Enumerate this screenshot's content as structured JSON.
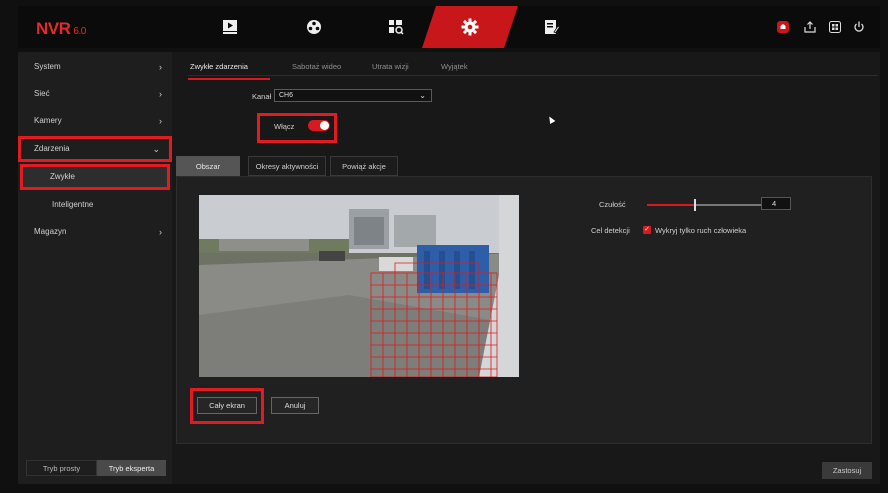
{
  "header": {
    "logo": "NVR",
    "version": "6.0",
    "nav": [
      "playback-icon",
      "camera-lens-icon",
      "search-file-icon",
      "settings-gear-icon",
      "edit-doc-icon"
    ],
    "active_nav": "settings-gear-icon",
    "system_icons": [
      "alarm-bell-icon",
      "backup-icon",
      "grid-icon",
      "power-icon"
    ],
    "accent": "#c8171b"
  },
  "sidebar": {
    "items": [
      {
        "label": "System",
        "chevron": "›"
      },
      {
        "label": "Sieć",
        "chevron": "›"
      },
      {
        "label": "Kamery",
        "chevron": "›"
      },
      {
        "label": "Zdarzenia",
        "chevron": "⌄"
      },
      {
        "label": "Zwykłe"
      },
      {
        "label": "Inteligentne"
      },
      {
        "label": "Magazyn",
        "chevron": "›"
      }
    ],
    "mode_simple": "Tryb prosty",
    "mode_expert": "Tryb eksperta"
  },
  "main": {
    "tabs": [
      "Zwykłe zdarzenia",
      "Sabotaż wideo",
      "Utrata wizji",
      "Wyjątek"
    ],
    "channel_label": "Kanał",
    "channel_value": "CH6",
    "enable_label": "Włącz",
    "enable_on": true,
    "panel_tabs": [
      "Obszar",
      "Okresy aktywności",
      "Powiąż akcje"
    ],
    "sensitivity_label": "Czułość",
    "sensitivity_value": "4",
    "detection_label": "Cel detekcji",
    "detection_option": "Wykryj tylko ruch człowieka",
    "fullscreen_button": "Cały ekran",
    "cancel_button": "Anuluj",
    "apply_button": "Zastosuj"
  }
}
